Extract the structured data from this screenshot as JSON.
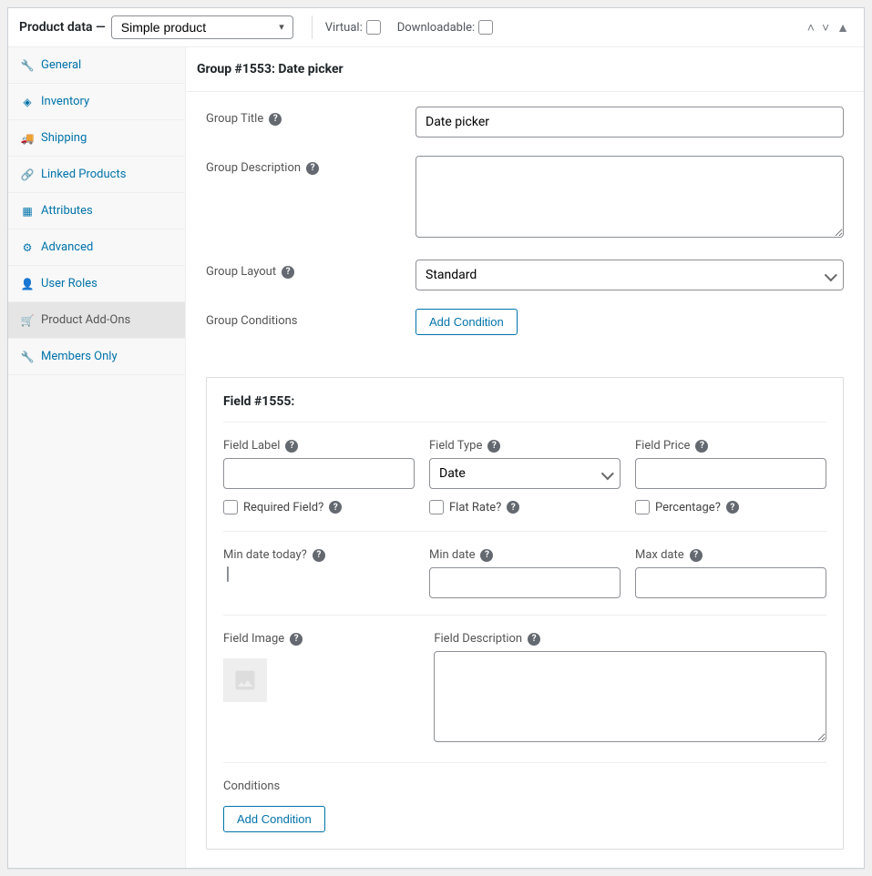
{
  "header": {
    "title": "Product data —",
    "product_type": "Simple product",
    "virtual_label": "Virtual:",
    "downloadable_label": "Downloadable:"
  },
  "tabs": [
    {
      "label": "General",
      "icon": "wrench"
    },
    {
      "label": "Inventory",
      "icon": "inventory"
    },
    {
      "label": "Shipping",
      "icon": "truck"
    },
    {
      "label": "Linked Products",
      "icon": "link"
    },
    {
      "label": "Attributes",
      "icon": "attributes"
    },
    {
      "label": "Advanced",
      "icon": "gear"
    },
    {
      "label": "User Roles",
      "icon": "user"
    },
    {
      "label": "Product Add-Ons",
      "icon": "cart"
    },
    {
      "label": "Members Only",
      "icon": "wrench"
    }
  ],
  "group": {
    "heading": "Group #1553: Date picker",
    "title_label": "Group Title",
    "title_value": "Date picker",
    "desc_label": "Group Description",
    "desc_value": "",
    "layout_label": "Group Layout",
    "layout_value": "Standard",
    "cond_label": "Group Conditions",
    "add_cond_btn": "Add Condition"
  },
  "field": {
    "heading": "Field #1555:",
    "label_label": "Field Label",
    "label_value": "",
    "type_label": "Field Type",
    "type_value": "Date",
    "price_label": "Field Price",
    "price_value": "",
    "required_label": "Required Field?",
    "flatrate_label": "Flat Rate?",
    "percentage_label": "Percentage?",
    "mindatetoday_label": "Min date today?",
    "mindate_label": "Min date",
    "mindate_value": "",
    "maxdate_label": "Max date",
    "maxdate_value": "",
    "image_label": "Field Image",
    "desc_label": "Field Description",
    "desc_value": "",
    "cond_label": "Conditions",
    "add_cond_btn": "Add Condition"
  }
}
